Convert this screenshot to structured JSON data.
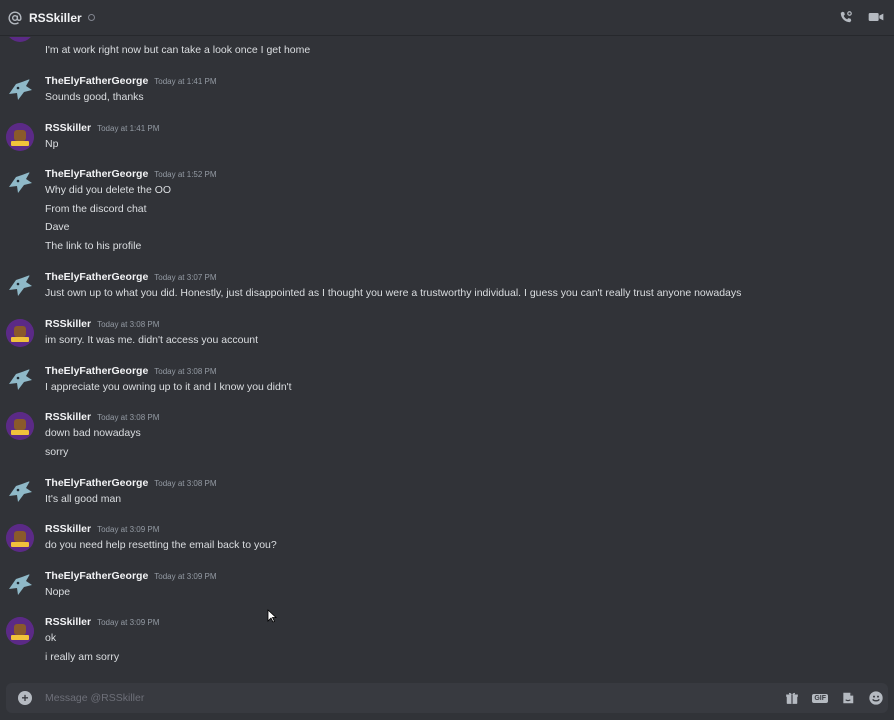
{
  "header": {
    "title": "RSSkiller",
    "icons": [
      "at-icon",
      "status-offline-icon",
      "voice-call-icon",
      "video-call-icon"
    ]
  },
  "messages": [
    {
      "author": "",
      "timestamp": "",
      "avatar": "rs",
      "lines": [
        "I'm at work right now but can take a look once I get home"
      ]
    },
    {
      "author": "TheElyFatherGeorge",
      "timestamp": "Today at 1:41 PM",
      "avatar": "ely",
      "lines": [
        "Sounds good, thanks"
      ]
    },
    {
      "author": "RSSkiller",
      "timestamp": "Today at 1:41 PM",
      "avatar": "rs",
      "lines": [
        "Np"
      ]
    },
    {
      "author": "TheElyFatherGeorge",
      "timestamp": "Today at 1:52 PM",
      "avatar": "ely",
      "lines": [
        "Why did you delete the OO",
        "From the discord chat",
        "Dave",
        "The link to his profile"
      ]
    },
    {
      "author": "TheElyFatherGeorge",
      "timestamp": "Today at 3:07 PM",
      "avatar": "ely",
      "lines": [
        "Just own up to what you did.  Honestly, just disappointed as I thought you were a trustworthy individual.  I guess you can't really trust anyone nowadays"
      ]
    },
    {
      "author": "RSSkiller",
      "timestamp": "Today at 3:08 PM",
      "avatar": "rs",
      "lines": [
        "im sorry. It was me. didn't access you account"
      ]
    },
    {
      "author": "TheElyFatherGeorge",
      "timestamp": "Today at 3:08 PM",
      "avatar": "ely",
      "lines": [
        "I appreciate you owning up to it and I know you didn't"
      ]
    },
    {
      "author": "RSSkiller",
      "timestamp": "Today at 3:08 PM",
      "avatar": "rs",
      "lines": [
        "down bad nowadays",
        "sorry"
      ]
    },
    {
      "author": "TheElyFatherGeorge",
      "timestamp": "Today at 3:08 PM",
      "avatar": "ely",
      "lines": [
        "It's all good man"
      ]
    },
    {
      "author": "RSSkiller",
      "timestamp": "Today at 3:09 PM",
      "avatar": "rs",
      "lines": [
        "do you need help resetting the email back to you?"
      ]
    },
    {
      "author": "TheElyFatherGeorge",
      "timestamp": "Today at 3:09 PM",
      "avatar": "ely",
      "lines": [
        "Nope"
      ]
    },
    {
      "author": "RSSkiller",
      "timestamp": "Today at 3:09 PM",
      "avatar": "rs",
      "lines": [
        "ok",
        "i really am sorry"
      ]
    }
  ],
  "composer": {
    "placeholder": "Message @RSSkiller",
    "gif_label": "GIF"
  },
  "colors": {
    "background": "#313338",
    "composer": "#383a40",
    "timestamp": "#949ba4",
    "text": "#dbdee1"
  }
}
